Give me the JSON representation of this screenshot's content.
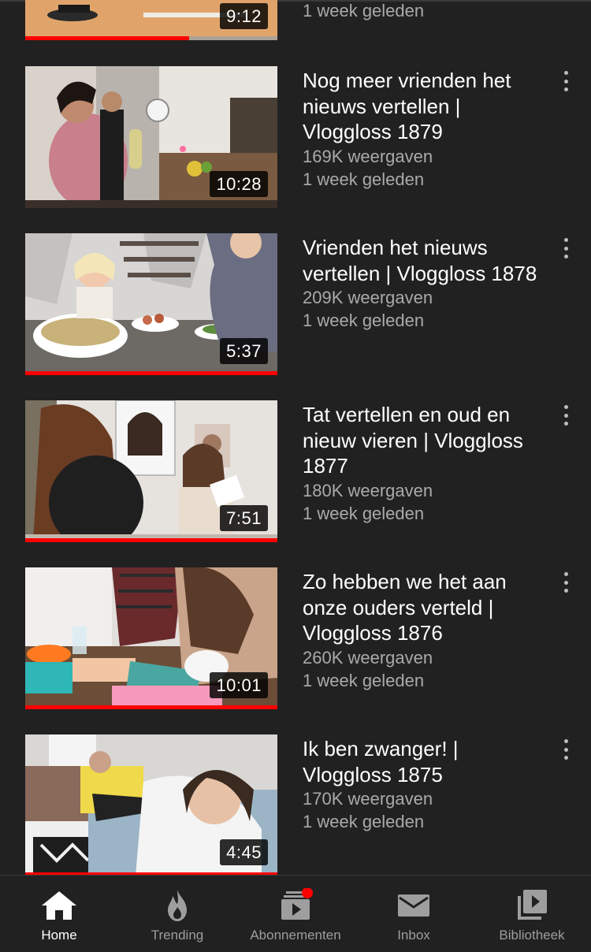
{
  "videos": [
    {
      "title": "",
      "views": "",
      "age": "1 week geleden",
      "duration": "9:12",
      "progress": 0.65,
      "partial": true
    },
    {
      "title": "Nog meer vrienden het nieuws vertellen | Vloggloss 1879",
      "views": "169K weergaven",
      "age": "1 week geleden",
      "duration": "10:28",
      "progress": 0
    },
    {
      "title": "Vrienden het nieuws vertellen | Vloggloss 1878",
      "views": "209K weergaven",
      "age": "1 week geleden",
      "duration": "5:37",
      "progress": 1
    },
    {
      "title": "Tat vertellen en oud en nieuw vieren | Vloggloss 1877",
      "views": "180K weergaven",
      "age": "1 week geleden",
      "duration": "7:51",
      "progress": 1
    },
    {
      "title": "Zo hebben we het aan onze ouders verteld | Vloggloss 1876",
      "views": "260K weergaven",
      "age": "1 week geleden",
      "duration": "10:01",
      "progress": 1
    },
    {
      "title": "Ik ben zwanger! | Vloggloss 1875",
      "views": "170K weergaven",
      "age": "1 week geleden",
      "duration": "4:45",
      "progress": 1
    }
  ],
  "nav": {
    "items": [
      {
        "label": "Home",
        "icon": "home-icon",
        "active": true
      },
      {
        "label": "Trending",
        "icon": "flame-icon",
        "active": false
      },
      {
        "label": "Abonnementen",
        "icon": "subscriptions-icon",
        "active": false,
        "badge": true
      },
      {
        "label": "Inbox",
        "icon": "mail-icon",
        "active": false
      },
      {
        "label": "Bibliotheek",
        "icon": "library-icon",
        "active": false
      }
    ]
  },
  "colors": {
    "background": "#212121",
    "progress": "#ff0000",
    "secondary_text": "#aaaaaa",
    "badge": "#ff0000"
  }
}
